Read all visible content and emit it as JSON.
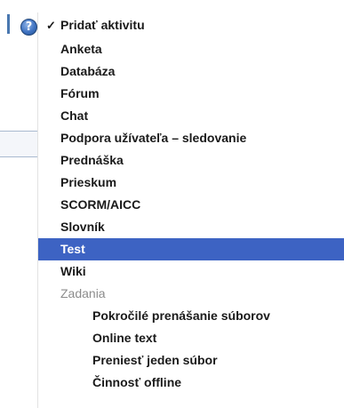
{
  "icons": {
    "help": "question-mark",
    "check": "checkmark"
  },
  "help_icon_glyph": "?",
  "menu": {
    "check_mark": "✓",
    "items": [
      {
        "label": "Pridať aktivitu"
      },
      {
        "label": "Anketa"
      },
      {
        "label": "Databáza"
      },
      {
        "label": "Fórum"
      },
      {
        "label": "Chat"
      },
      {
        "label": "Podpora užívateľa – sledovanie"
      },
      {
        "label": "Prednáška"
      },
      {
        "label": "Prieskum"
      },
      {
        "label": "SCORM/AICC"
      },
      {
        "label": "Slovník"
      },
      {
        "label": "Test"
      },
      {
        "label": "Wiki"
      },
      {
        "label": "Zadania"
      },
      {
        "label": "Pokročilé prenášanie súborov"
      },
      {
        "label": "Online text"
      },
      {
        "label": "Preniesť jeden súbor"
      },
      {
        "label": "Činnosť offline"
      }
    ],
    "selected_index": 10
  },
  "colors": {
    "selected_background": "#3d63c3",
    "selected_text": "#ffffff",
    "group_header_text": "#8c8c8c"
  }
}
